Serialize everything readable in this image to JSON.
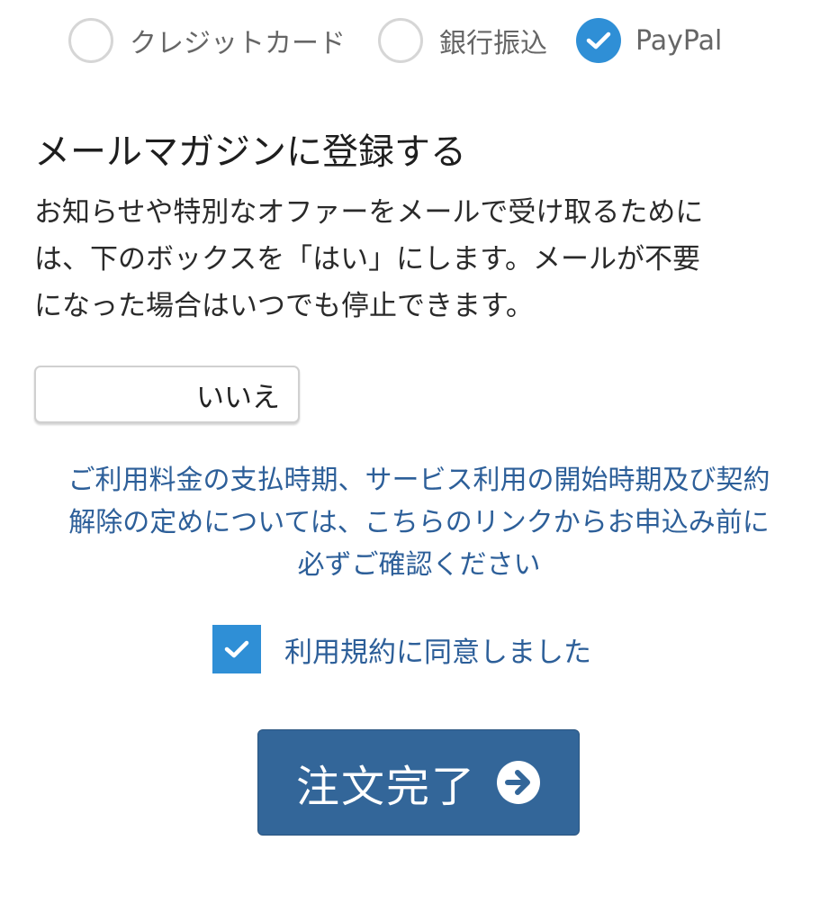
{
  "payment": {
    "options": [
      {
        "label": "クレジットカード",
        "selected": false
      },
      {
        "label": "銀行振込",
        "selected": false
      },
      {
        "label": "PayPal",
        "selected": true
      }
    ]
  },
  "newsletter": {
    "title": "メールマガジンに登録する",
    "description_lines": [
      "お知らせや特別なオファーをメールで受け取るために",
      "は、下のボックスを「はい」にします。メールが不要",
      "になった場合はいつでも停止できます。"
    ],
    "select_value": "いいえ"
  },
  "terms": {
    "link_lines": [
      "ご利用料金の支払時期、サービス利用の開始時期及び契約",
      "解除の定めについては、こちらのリンクからお申込み前に",
      "必ずご確認ください"
    ],
    "agree_label": "利用規約に同意しました",
    "agree_checked": true
  },
  "submit": {
    "label": "注文完了"
  },
  "colors": {
    "accent": "#2f8fd6",
    "button": "#336699",
    "link": "#2d5f99"
  }
}
